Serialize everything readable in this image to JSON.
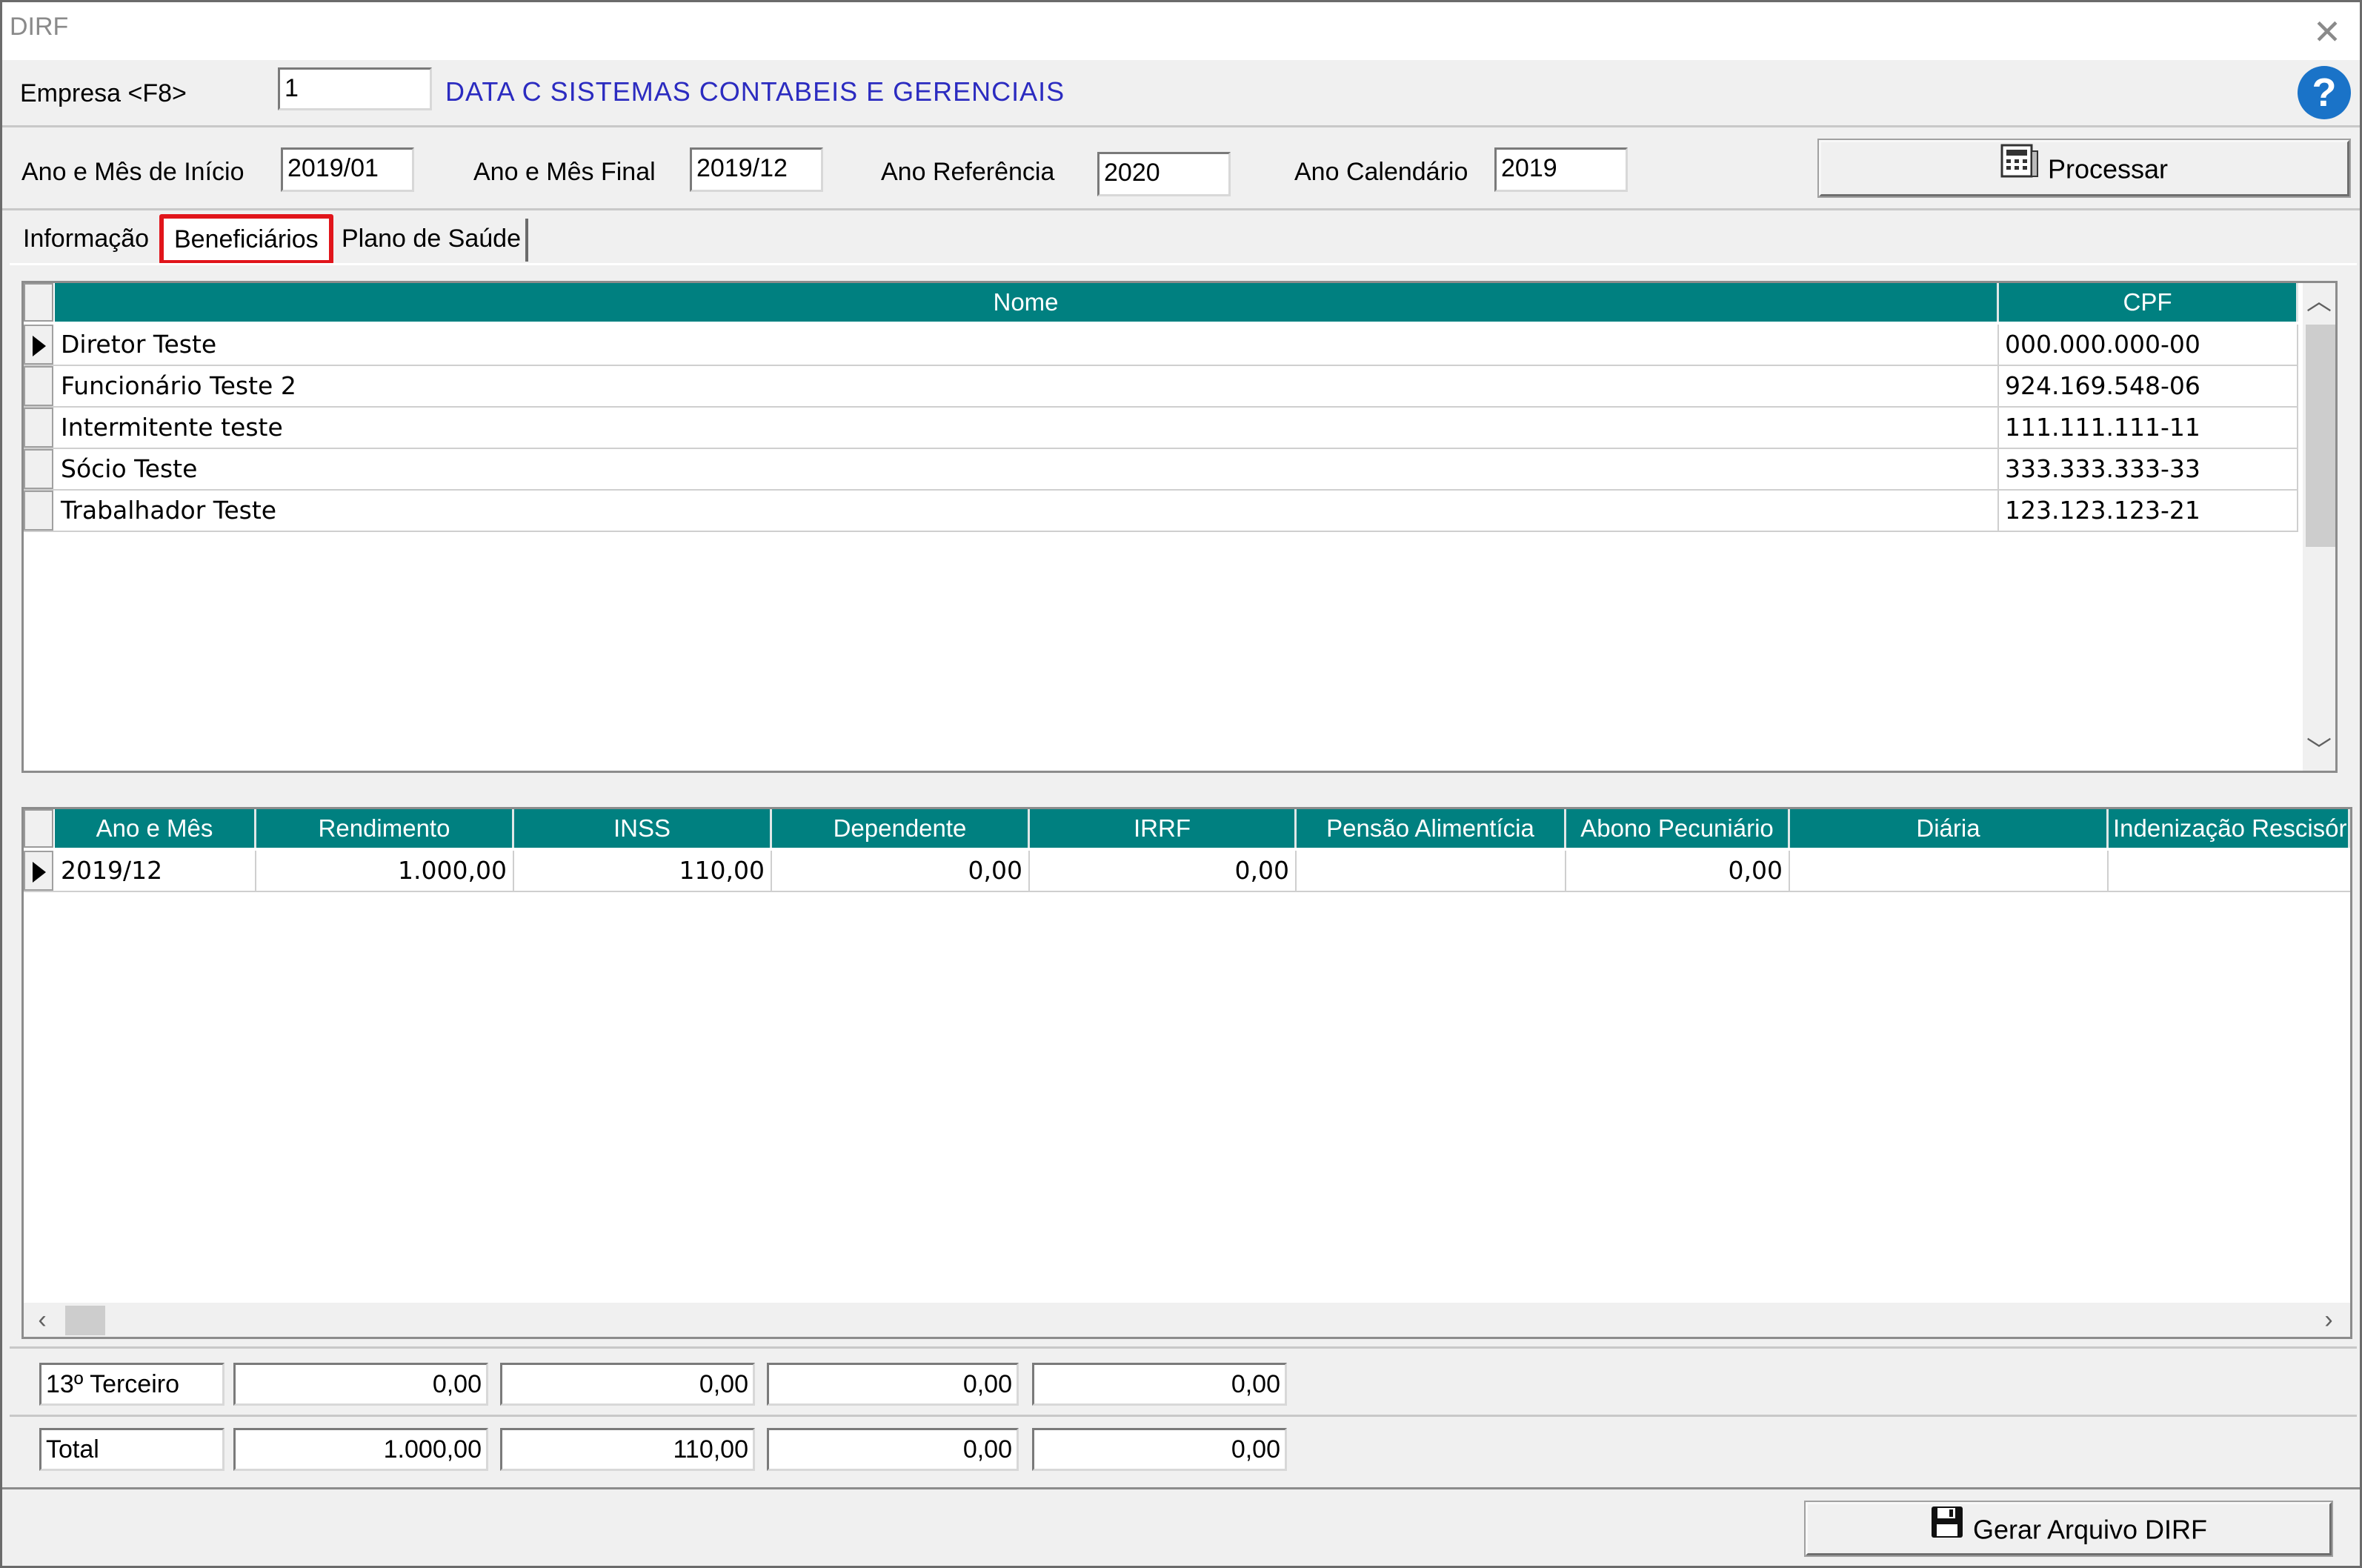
{
  "window": {
    "title": "DIRF"
  },
  "empresa": {
    "label": "Empresa <F8>",
    "code": "1",
    "name": "DATA C SISTEMAS CONTABEIS E GERENCIAIS"
  },
  "periodo": {
    "inicio_label": "Ano e Mês de Início",
    "inicio_value": "2019/01",
    "final_label": "Ano e Mês Final",
    "final_value": "2019/12",
    "referencia_label": "Ano Referência",
    "referencia_value": "2020",
    "calendario_label": "Ano Calendário",
    "calendario_value": "2019",
    "processar_label": "Processar"
  },
  "tabs": [
    {
      "label": "Informação",
      "active": false
    },
    {
      "label": "Beneficiários",
      "active": true
    },
    {
      "label": "Plano de Saúde",
      "active": false
    }
  ],
  "beneficiarios": {
    "columns": [
      "Nome",
      "CPF"
    ],
    "rows": [
      {
        "nome": "Diretor Teste",
        "cpf": "000.000.000-00",
        "selected": true
      },
      {
        "nome": "Funcionário Teste 2",
        "cpf": "924.169.548-06",
        "selected": false
      },
      {
        "nome": "Intermitente teste",
        "cpf": "111.111.111-11",
        "selected": false
      },
      {
        "nome": "Sócio Teste",
        "cpf": "333.333.333-33",
        "selected": false
      },
      {
        "nome": "Trabalhador Teste",
        "cpf": "123.123.123-21",
        "selected": false
      }
    ]
  },
  "rendimentos": {
    "columns": [
      "Ano e Mês",
      "Rendimento",
      "INSS",
      "Dependente",
      "IRRF",
      "Pensão Alimentícia",
      "Abono Pecuniário",
      "Diária",
      "Indenização Rescisória"
    ],
    "rows": [
      [
        "2019/12",
        "1.000,00",
        "110,00",
        "0,00",
        "0,00",
        "",
        "0,00",
        "",
        ""
      ]
    ]
  },
  "totais": {
    "terceiro_label": "13º Terceiro",
    "terceiro_values": [
      "0,00",
      "0,00",
      "0,00",
      "0,00"
    ],
    "total_label": "Total",
    "total_values": [
      "1.000,00",
      "110,00",
      "0,00",
      "0,00"
    ]
  },
  "footer": {
    "gerar_label": "Gerar Arquivo DIRF"
  },
  "colors": {
    "header_teal": "#008080",
    "highlight_red": "#e1151b",
    "company_blue": "#2b2bc0"
  }
}
